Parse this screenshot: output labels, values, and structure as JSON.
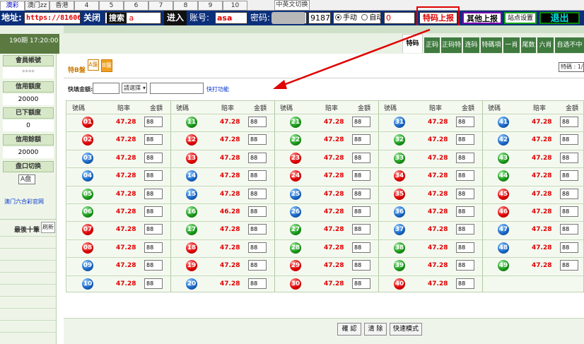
{
  "top_tabs": [
    {
      "label": "澳彩",
      "active": true
    },
    {
      "label": "澳门zz",
      "active": false
    },
    {
      "label": "香港",
      "active": false
    },
    {
      "label": "4",
      "active": false
    },
    {
      "label": "5",
      "active": false
    },
    {
      "label": "6",
      "active": false
    },
    {
      "label": "7",
      "active": false
    },
    {
      "label": "8",
      "active": false
    },
    {
      "label": "9",
      "active": false
    },
    {
      "label": "10",
      "active": false
    }
  ],
  "lang_switch_label": "中英文切换",
  "toolbar": {
    "address_label": "地址:",
    "address_value": "https://81606.",
    "open_button": "关闭",
    "search_button": "搜索",
    "search_tail": "a",
    "enter_button": "进入",
    "account_label": "账号:",
    "account_value": "asa",
    "password_label": "密码:",
    "password_tail": "58369",
    "code_value": "9187",
    "manual_label": "手动",
    "auto_label": "自动",
    "counter_value": "0",
    "special_report_button": "特码上报",
    "other_report_button": "其他上报",
    "site_settings_button": "站点设置",
    "logout_button": "退出"
  },
  "period_label": "190期 17:20:00",
  "game_tabs": [
    "特码",
    "正码",
    "正码特",
    "连码",
    "特碼項",
    "一肖",
    "尾数",
    "六肖",
    "自选不中"
  ],
  "sidebar": {
    "member_account_label": "會員帳號",
    "member_account_value": "****",
    "credit_limit_label": "信用額度",
    "credit_limit_value": "20000",
    "bet_amount_label": "已下額度",
    "bet_amount_value": "0",
    "credit_balance_label": "信用餘額",
    "credit_balance_value": "20000",
    "market_switch_label": "盘口切换",
    "market_switch_value": "A盘",
    "site_link": "澳门六合彩官网",
    "recent_label": "最後十筆",
    "refresh_button": "刷新"
  },
  "main": {
    "section_title": "特B盤",
    "plate_a": "A盤",
    "plate_b": "B盤",
    "top_right_label": "特碼 : 1/2",
    "quick_amount_label": "快填金額:",
    "select_placeholder": "請選擇",
    "quick_function_link": "快打功能",
    "column_headers": {
      "number": "號碼",
      "odds": "賠率",
      "amount": "金額"
    }
  },
  "numbers": [
    {
      "num": "01",
      "odds": "47.28",
      "color": "red"
    },
    {
      "num": "02",
      "odds": "47.28",
      "color": "red"
    },
    {
      "num": "03",
      "odds": "47.28",
      "color": "blue"
    },
    {
      "num": "04",
      "odds": "47.28",
      "color": "blue"
    },
    {
      "num": "05",
      "odds": "47.28",
      "color": "green"
    },
    {
      "num": "06",
      "odds": "47.28",
      "color": "green"
    },
    {
      "num": "07",
      "odds": "47.28",
      "color": "red"
    },
    {
      "num": "08",
      "odds": "47.28",
      "color": "red"
    },
    {
      "num": "09",
      "odds": "47.28",
      "color": "blue"
    },
    {
      "num": "10",
      "odds": "47.28",
      "color": "blue"
    },
    {
      "num": "11",
      "odds": "47.28",
      "color": "green"
    },
    {
      "num": "12",
      "odds": "47.28",
      "color": "red"
    },
    {
      "num": "13",
      "odds": "47.28",
      "color": "red"
    },
    {
      "num": "14",
      "odds": "47.28",
      "color": "blue"
    },
    {
      "num": "15",
      "odds": "47.28",
      "color": "blue"
    },
    {
      "num": "16",
      "odds": "46.28",
      "color": "green"
    },
    {
      "num": "17",
      "odds": "47.28",
      "color": "green"
    },
    {
      "num": "18",
      "odds": "47.28",
      "color": "red"
    },
    {
      "num": "19",
      "odds": "47.28",
      "color": "red"
    },
    {
      "num": "20",
      "odds": "47.28",
      "color": "blue"
    },
    {
      "num": "21",
      "odds": "47.28",
      "color": "green"
    },
    {
      "num": "22",
      "odds": "47.28",
      "color": "green"
    },
    {
      "num": "23",
      "odds": "47.28",
      "color": "red"
    },
    {
      "num": "24",
      "odds": "47.28",
      "color": "red"
    },
    {
      "num": "25",
      "odds": "47.28",
      "color": "blue"
    },
    {
      "num": "26",
      "odds": "47.28",
      "color": "blue"
    },
    {
      "num": "27",
      "odds": "47.28",
      "color": "green"
    },
    {
      "num": "28",
      "odds": "47.28",
      "color": "green"
    },
    {
      "num": "29",
      "odds": "47.28",
      "color": "red"
    },
    {
      "num": "30",
      "odds": "47.28",
      "color": "red"
    },
    {
      "num": "31",
      "odds": "47.28",
      "color": "blue"
    },
    {
      "num": "32",
      "odds": "47.28",
      "color": "green"
    },
    {
      "num": "33",
      "odds": "47.28",
      "color": "green"
    },
    {
      "num": "34",
      "odds": "47.28",
      "color": "red"
    },
    {
      "num": "35",
      "odds": "47.28",
      "color": "red"
    },
    {
      "num": "36",
      "odds": "47.28",
      "color": "blue"
    },
    {
      "num": "37",
      "odds": "47.28",
      "color": "blue"
    },
    {
      "num": "38",
      "odds": "47.28",
      "color": "green"
    },
    {
      "num": "39",
      "odds": "47.28",
      "color": "green"
    },
    {
      "num": "40",
      "odds": "47.28",
      "color": "red"
    },
    {
      "num": "41",
      "odds": "47.28",
      "color": "blue"
    },
    {
      "num": "42",
      "odds": "47.28",
      "color": "blue"
    },
    {
      "num": "43",
      "odds": "47.28",
      "color": "green"
    },
    {
      "num": "44",
      "odds": "47.28",
      "color": "green"
    },
    {
      "num": "45",
      "odds": "47.28",
      "color": "red"
    },
    {
      "num": "46",
      "odds": "47.28",
      "color": "red"
    },
    {
      "num": "47",
      "odds": "47.28",
      "color": "blue"
    },
    {
      "num": "48",
      "odds": "47.28",
      "color": "blue"
    },
    {
      "num": "49",
      "odds": "47.28",
      "color": "green"
    }
  ],
  "amount_default": "88",
  "bottom_buttons": {
    "confirm": "確 認",
    "clear": "清 除",
    "quick_mode": "快速模式"
  },
  "colors": {
    "toolbar_bg": "#0b2f7a",
    "tab_green": "#3f7a3f",
    "ball_red": "#e00000",
    "ball_blue": "#1a68c8",
    "ball_green": "#1a9a1a",
    "annotation_red": "#e00000"
  }
}
